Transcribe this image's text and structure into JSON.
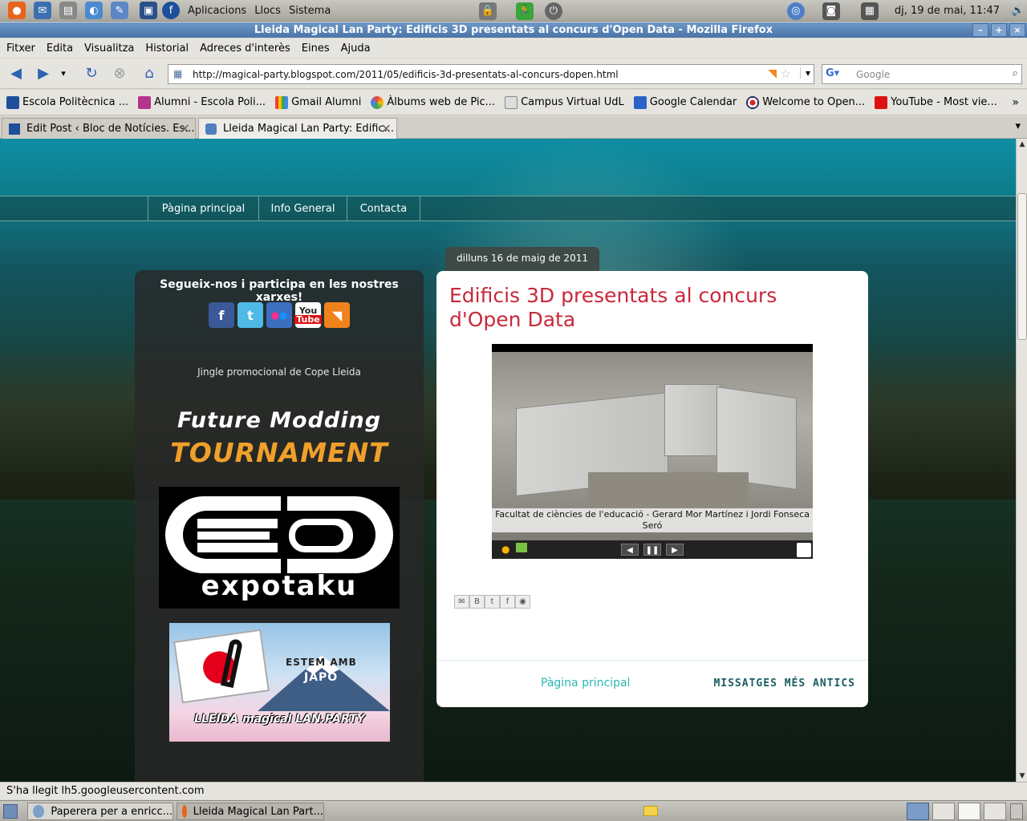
{
  "top_panel": {
    "menus": [
      "Aplicacions",
      "Llocs",
      "Sistema"
    ],
    "clock": "dj, 19 de mai, 11:47"
  },
  "window": {
    "title": "Lleida Magical Lan Party: Edificis 3D presentats al concurs d'Open Data - Mozilla Firefox"
  },
  "menubar": [
    "Fitxer",
    "Edita",
    "Visualitza",
    "Historial",
    "Adreces d'interès",
    "Eines",
    "Ajuda"
  ],
  "navbar": {
    "url": "http://magical-party.blogspot.com/2011/05/edificis-3d-presentats-al-concurs-dopen.html",
    "search_placeholder": "Google"
  },
  "bookmarks": [
    "Escola Politècnica ...",
    "Alumni - Escola Poli...",
    "Gmail Alumni",
    "Àlbums web de Pic...",
    "Campus Virtual UdL",
    "Google Calendar",
    "Welcome to Open...",
    "YouTube - Most vie..."
  ],
  "tabs": [
    {
      "label": "Edit Post ‹ Bloc de Notícies. Es..."
    },
    {
      "label": "Lleida Magical Lan Party: Edific..."
    }
  ],
  "blog": {
    "nav": [
      "Pàgina principal",
      "Info General",
      "Contacta"
    ],
    "sidebar": {
      "title": "Segueix-nos i participa en les nostres xarxes!",
      "youtube_line1": "You",
      "youtube_line2": "Tube",
      "jingle": "Jingle promocional de Cope Lleida",
      "fm_line1": "Future Modding",
      "fm_line2": "TOURNAMENT",
      "expotaku": "expotaku",
      "japo_line1": "ESTEM AMB",
      "japo_line2": "JAPÓ",
      "japo_line3": "LLEIDA magical LAN.PARTY"
    },
    "post": {
      "date": "dilluns 16 de maig de 2011",
      "title": "Edificis 3D presentats al concurs d'Open Data",
      "video_caption": "Facultat de ciències de l'educació - Gerard Mor Martínez i Jordi Fonseca Seró",
      "home_link": "Pàgina principal",
      "older_link": "MISSATGES MÉS ANTICS"
    }
  },
  "status": "S'ha llegit lh5.googleusercontent.com",
  "taskbar": [
    "Paperera per a enricc...",
    "Lleida Magical Lan Part..."
  ],
  "colors": {
    "post_title": "#c8283a",
    "link_teal": "#2ab7b3",
    "titlebar": "#5a83b5"
  }
}
